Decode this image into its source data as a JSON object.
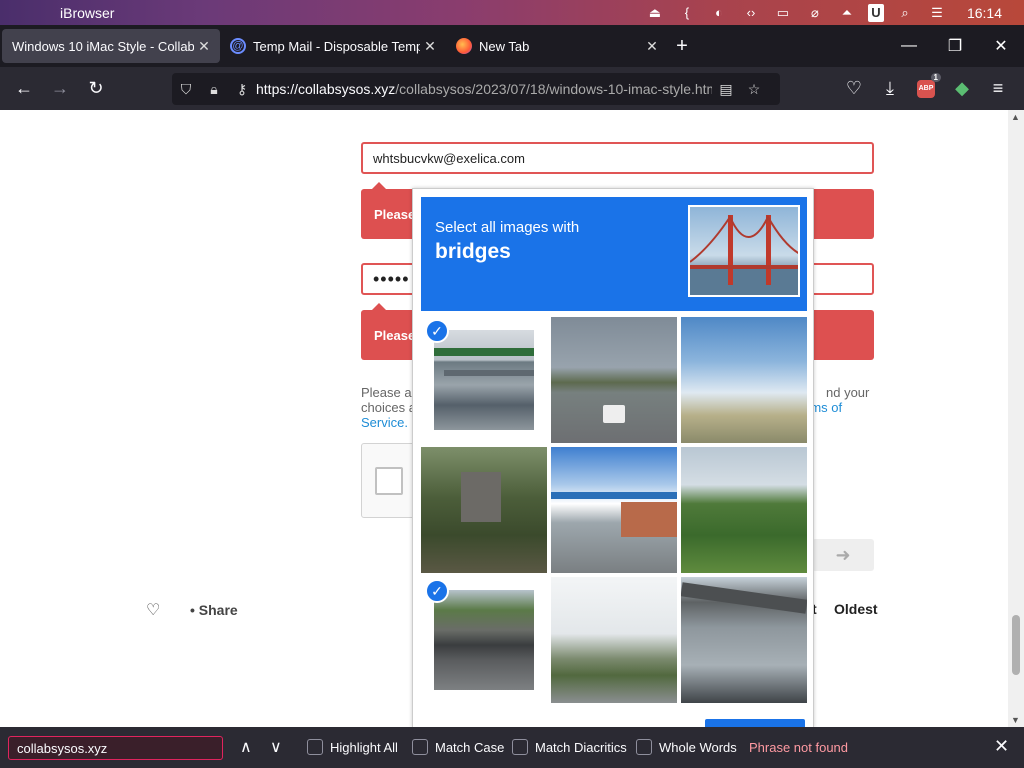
{
  "menubar": {
    "app_name": "iBrowser",
    "clock": "16:14",
    "icons": [
      "apple-icon",
      "eject-icon",
      "brackets-icon",
      "contrast-icon",
      "code-icon",
      "monitor-icon",
      "no-wifi-icon",
      "upload-icon",
      "u-icon",
      "search-icon",
      "toggle-icon"
    ]
  },
  "tabs": [
    {
      "title": "Windows 10 iMac Style - CollabSys",
      "active": true
    },
    {
      "title": "Temp Mail - Disposable Tempo",
      "active": false
    },
    {
      "title": "New Tab",
      "active": false
    }
  ],
  "navbar": {
    "url_domain": "https://collabsysos.xyz",
    "url_path": "/collabsysos/2023/07/18/windows-10-imac-style.htm",
    "abp_badge": "1",
    "abp_label": "ABP"
  },
  "form": {
    "email_value": "whtsbucvkw@exelica.com",
    "error_1": "Please",
    "password_mask": "•••••",
    "error_2": "Please",
    "terms_start_1": "Please ac",
    "terms_end_1": "nd your",
    "terms_start_2": "choices a",
    "terms_end_2": "rms of",
    "terms_start_3": "Service.",
    "submit_arrow": "➜"
  },
  "comments": {
    "share_label": "Share",
    "sort_partial": "t",
    "sort_oldest": "Oldest"
  },
  "captcha": {
    "instruction_line1": "Select all images with",
    "instruction_line2": "bridges",
    "tiles_selected": [
      true,
      false,
      false,
      false,
      false,
      false,
      true,
      false,
      false
    ]
  },
  "findbar": {
    "query": "collabsysos.xyz",
    "options": [
      "Highlight All",
      "Match Case",
      "Match Diacritics",
      "Whole Words"
    ],
    "status": "Phrase not found"
  },
  "colors": {
    "captcha_blue": "#1a73e8",
    "error_red": "#dd5050",
    "link_blue": "#1f8dd6"
  }
}
